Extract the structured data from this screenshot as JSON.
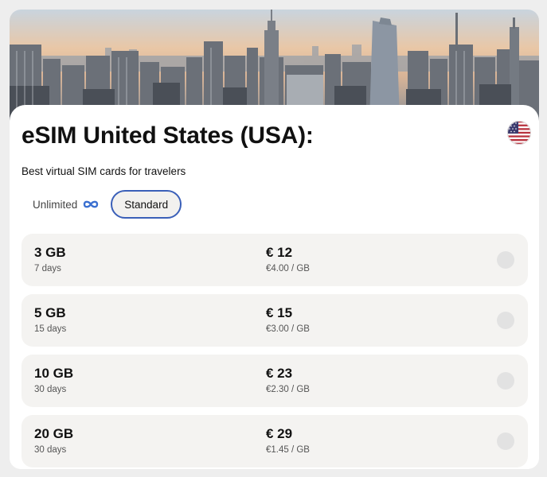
{
  "header": {
    "title": "eSIM United States (USA):",
    "subtitle": "Best virtual SIM cards for travelers"
  },
  "tabs": [
    {
      "label": "Unlimited",
      "icon": "infinity-icon",
      "active": false
    },
    {
      "label": "Standard",
      "active": true
    }
  ],
  "plans": [
    {
      "data": "3 GB",
      "duration": "7 days",
      "price": "€ 12",
      "per_gb": "€4.00 / GB"
    },
    {
      "data": "5 GB",
      "duration": "15 days",
      "price": "€ 15",
      "per_gb": "€3.00 / GB"
    },
    {
      "data": "10 GB",
      "duration": "30 days",
      "price": "€ 23",
      "per_gb": "€2.30 / GB"
    },
    {
      "data": "20 GB",
      "duration": "30 days",
      "price": "€ 29",
      "per_gb": "€1.45 / GB"
    }
  ],
  "colors": {
    "accent": "#3a5fb8",
    "infinity": "#3a6fd0",
    "card_bg": "#f4f3f1"
  }
}
